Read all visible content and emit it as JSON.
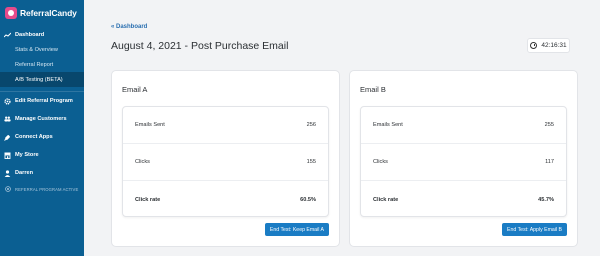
{
  "brand": {
    "name": "ReferralCandy"
  },
  "sidebar": {
    "dashboard": "Dashboard",
    "sub_items": [
      "Stats & Overview",
      "Referral Report",
      "A/B Testing (BETA)"
    ],
    "sections": [
      "Edit Referral Program",
      "Manage Customers",
      "Connect Apps",
      "My Store",
      "Darren"
    ],
    "status": "REFERRAL PROGRAM ACTIVE"
  },
  "main": {
    "back_link": "« Dashboard",
    "title": "August 4, 2021 - Post Purchase Email",
    "timer": "42:16:31"
  },
  "cards": [
    {
      "title": "Email A",
      "rows": [
        {
          "label": "Emails Sent",
          "value": "256"
        },
        {
          "label": "Clicks",
          "value": "155"
        },
        {
          "label": "Click rate",
          "value": "60.5%"
        }
      ],
      "button": "End Test: Keep Email A"
    },
    {
      "title": "Email B",
      "rows": [
        {
          "label": "Emails Sent",
          "value": "255"
        },
        {
          "label": "Clicks",
          "value": "117"
        },
        {
          "label": "Click rate",
          "value": "45.7%"
        }
      ],
      "button": "End Test: Apply Email B"
    }
  ],
  "colors": {
    "sidebar": "#0b5f92",
    "active": "#08476d",
    "accent": "#1a7cc4",
    "brand": "#e64b8b"
  }
}
